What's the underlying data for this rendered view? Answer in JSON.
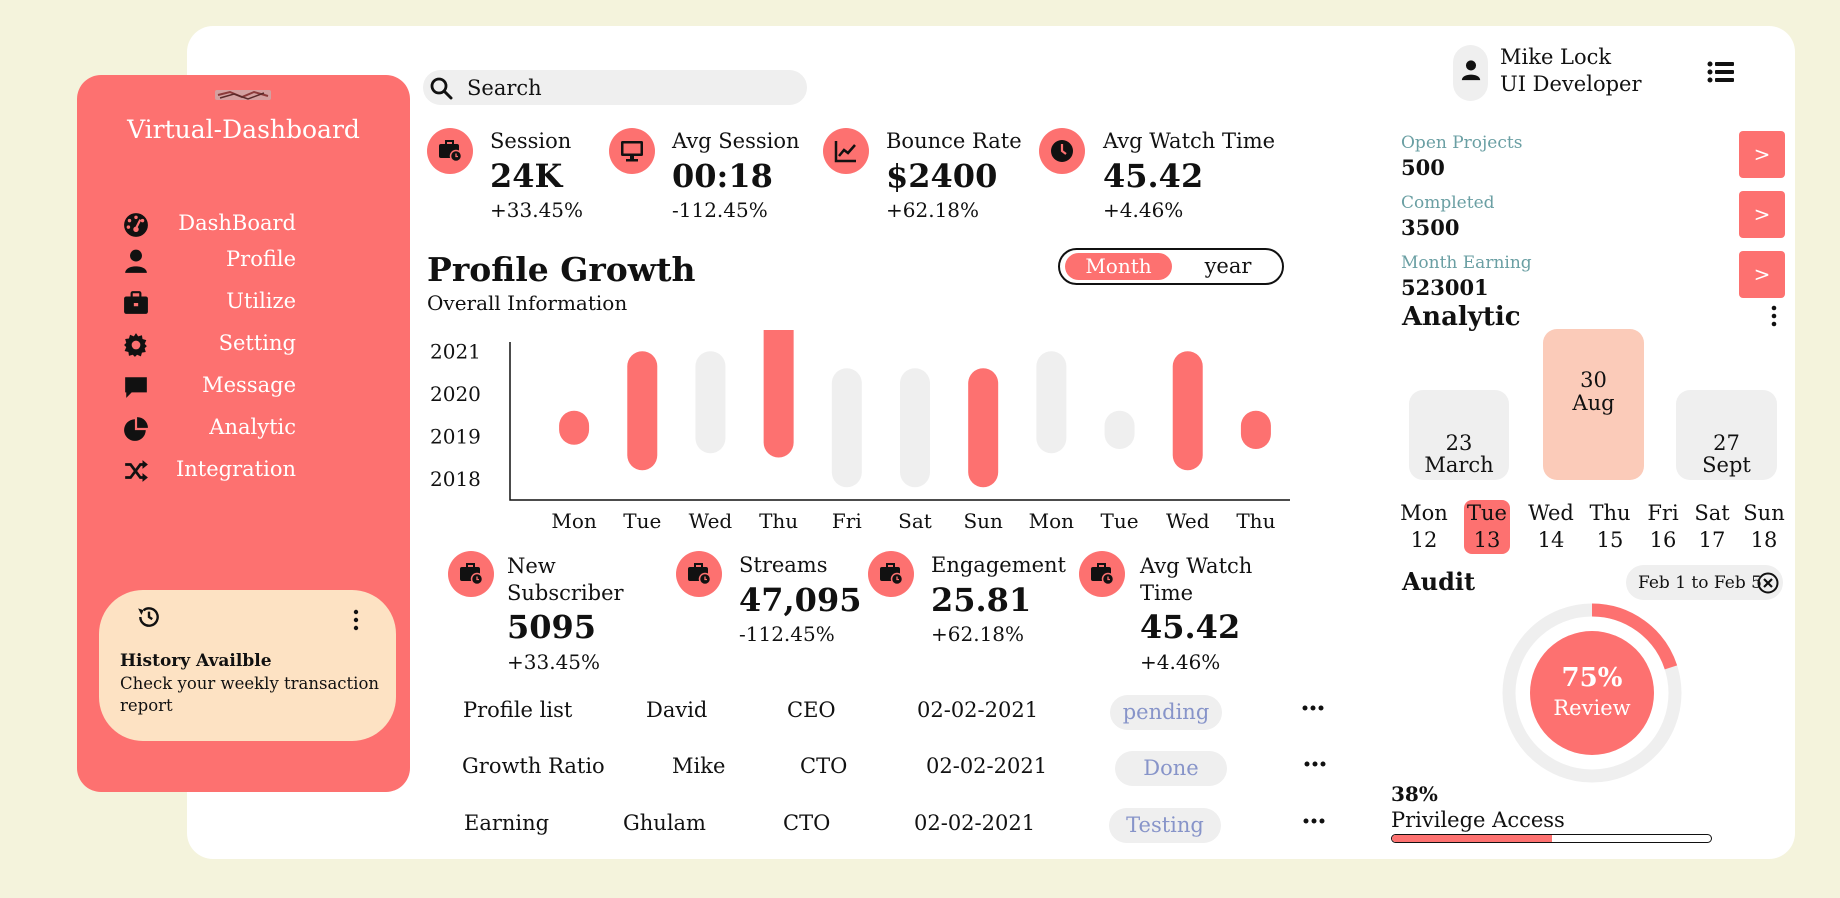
{
  "sidebar": {
    "brand": "Virtual-Dashboard",
    "items": [
      {
        "label": "DashBoard",
        "icon": "dashboard-icon"
      },
      {
        "label": "Profile",
        "icon": "user-icon"
      },
      {
        "label": "Utilize",
        "icon": "briefcase-icon"
      },
      {
        "label": "Setting",
        "icon": "gear-icon"
      },
      {
        "label": "Message",
        "icon": "message-icon"
      },
      {
        "label": "Analytic",
        "icon": "pie-chart-icon"
      },
      {
        "label": "Integration",
        "icon": "shuffle-icon"
      }
    ],
    "history": {
      "title": "History Availble",
      "description": "Check your weekly transaction report"
    }
  },
  "search": {
    "placeholder": "Search"
  },
  "top_stats": [
    {
      "label": "Session",
      "value": "24K",
      "change": "+33.45%"
    },
    {
      "label": "Avg Session",
      "value": "00:18",
      "change": "-112.45%"
    },
    {
      "label": "Bounce Rate",
      "value": "$2400",
      "change": "+62.18%"
    },
    {
      "label": "Avg Watch Time",
      "value": "45.42",
      "change": "+4.46%"
    }
  ],
  "profile_growth": {
    "title": "Profile Growth",
    "subtitle": "Overall Information",
    "toggle": {
      "active": "Month",
      "inactive": "year"
    }
  },
  "chart_data": {
    "type": "bar",
    "categories": [
      "Mon",
      "Tue",
      "Wed",
      "Thu",
      "Fri",
      "Sat",
      "Sun",
      "Mon",
      "Tue",
      "Wed",
      "Thu"
    ],
    "y_tick_labels": [
      "2021",
      "2020",
      "2019",
      "2018"
    ],
    "ylim": [
      2017.5,
      2021.5
    ],
    "series": [
      {
        "values": [
          [
            2018.8,
            2019.6
          ],
          [
            2018.2,
            2021.0
          ],
          [
            2018.6,
            2021.0
          ],
          [
            2018.5,
            2021.9
          ],
          [
            2017.8,
            2020.6
          ],
          [
            2017.8,
            2020.6
          ],
          [
            2017.8,
            2020.6
          ],
          [
            2018.6,
            2021.0
          ],
          [
            2018.7,
            2019.6
          ],
          [
            2018.2,
            2021.0
          ],
          [
            2018.7,
            2019.6
          ]
        ]
      }
    ],
    "highlighted": [
      true,
      true,
      false,
      true,
      false,
      false,
      true,
      false,
      false,
      true,
      true
    ],
    "colors": {
      "highlight": "#fd7170",
      "muted": "#efefef"
    },
    "grid": false
  },
  "bottom_stats": [
    {
      "label": "New Subscriber",
      "value": "5095",
      "change": "+33.45%"
    },
    {
      "label": "Streams",
      "value": "47,095",
      "change": "-112.45%"
    },
    {
      "label": "Engagement",
      "value": "25.81",
      "change": "+62.18%"
    },
    {
      "label": "Avg Watch Time",
      "value": "45.42",
      "change": "+4.46%"
    }
  ],
  "table": [
    {
      "name": "Profile list",
      "person": "David",
      "role": "CEO",
      "date": "02-02-2021",
      "status": "pending"
    },
    {
      "name": "Growth Ratio",
      "person": "Mike",
      "role": "CTO",
      "date": "02-02-2021",
      "status": "Done"
    },
    {
      "name": "Earning",
      "person": "Ghulam",
      "role": "CTO",
      "date": "02-02-2021",
      "status": "Testing"
    }
  ],
  "user": {
    "name": "Mike Lock",
    "role": "UI Developer"
  },
  "summary": [
    {
      "label": "Open Projects",
      "value": "500",
      "button": ">"
    },
    {
      "label": "Completed",
      "value": "3500",
      "button": ">"
    },
    {
      "label": "Month Earning",
      "value": "523001",
      "button": ">"
    }
  ],
  "analytic": {
    "title": "Analytic",
    "cards": [
      {
        "day": "23",
        "month": "March"
      },
      {
        "day": "30",
        "month": "Aug"
      },
      {
        "day": "27",
        "month": "Sept"
      }
    ],
    "week": [
      {
        "day": "Mon",
        "date": "12"
      },
      {
        "day": "Tue",
        "date": "13"
      },
      {
        "day": "Wed",
        "date": "14"
      },
      {
        "day": "Thu",
        "date": "15"
      },
      {
        "day": "Fri",
        "date": "16"
      },
      {
        "day": "Sat",
        "date": "17"
      },
      {
        "day": "Sun",
        "date": "18"
      }
    ],
    "selected_day": "Tue"
  },
  "audit": {
    "title": "Audit",
    "range": "Feb 1 to Feb 5",
    "review_percent": "75%",
    "review_label": "Review",
    "ring_progress": 0.2
  },
  "privilege": {
    "percent": "38%",
    "label": "Privilege Access",
    "progress": 0.5
  },
  "colors": {
    "accent": "#fd7170",
    "cream": "#fde2c3",
    "background": "#f4f3dc",
    "muted": "#efefef",
    "teal": "#6a9fa3"
  }
}
